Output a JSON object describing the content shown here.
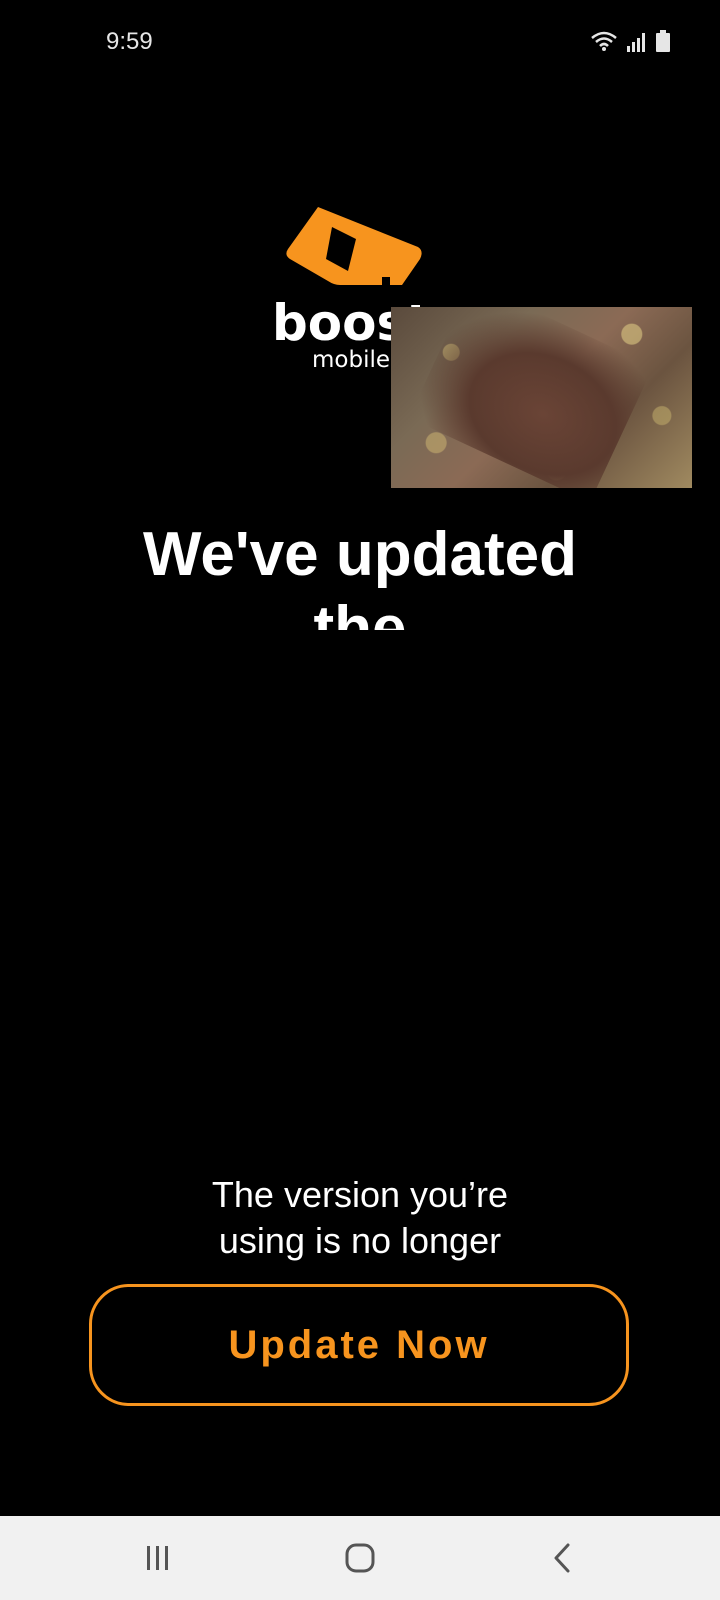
{
  "status_bar": {
    "time": "9:59",
    "icons": [
      "wifi-icon",
      "signal-icon",
      "battery-icon"
    ]
  },
  "logo": {
    "text_main": "boost",
    "text_sub": "mobile",
    "brand_color": "#f7941e"
  },
  "video_overlay": {
    "description_icon": "video-thumbnail"
  },
  "headline": {
    "line1": "We've updated",
    "line2": "the"
  },
  "message": {
    "line1": "The version you’re",
    "line2": "using is no longer"
  },
  "update_button": {
    "label": "Update Now",
    "color": "#f7941e"
  },
  "nav_bar": {
    "buttons": [
      "recents-icon",
      "home-icon",
      "back-icon"
    ]
  }
}
